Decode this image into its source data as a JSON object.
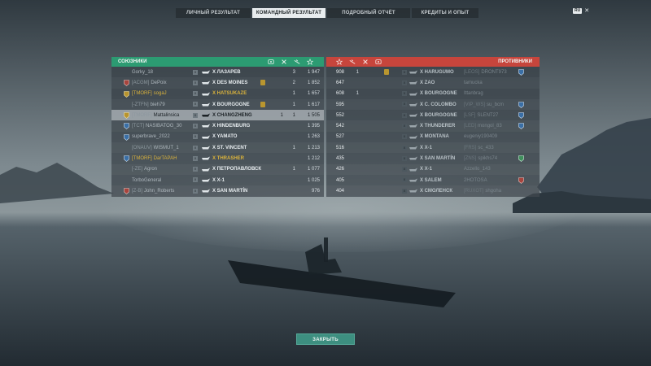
{
  "tabs": [
    {
      "label": "ЛИЧНЫЙ РЕЗУЛЬТАТ"
    },
    {
      "label": "КОМАНДНЫЙ РЕЗУЛЬТАТ"
    },
    {
      "label": "ПОДРОБНЫЙ ОТЧЁТ"
    },
    {
      "label": "КРЕДИТЫ И ОПЫТ"
    }
  ],
  "lang_badge": "RU",
  "close_glyph": "✕",
  "allies": {
    "title": "СОЮЗНИКИ",
    "color": "#2c9b72",
    "column_icons": [
      "plane-icon",
      "ship-kill-icon",
      "plane-kill-icon",
      "star-icon"
    ],
    "rows": [
      {
        "clan": "",
        "player": "Gorky_18",
        "tier": "X",
        "ship": "X ЛАЗАРЕВ",
        "badge": false,
        "kills": "",
        "planes": "3",
        "score": "1 947",
        "rank": "none",
        "hl": false,
        "gold": false
      },
      {
        "clan": "[ACGM]",
        "player": "DePoix",
        "tier": "X",
        "ship": "X DES MOINES",
        "badge": true,
        "kills": "",
        "planes": "2",
        "score": "1 852",
        "rank": "red",
        "hl": false,
        "gold": false
      },
      {
        "clan": "[TMORF]",
        "player": "sogaJ",
        "tier": "X",
        "ship": "X HATSUKAZE",
        "badge": false,
        "kills": "",
        "planes": "1",
        "score": "1 657",
        "rank": "gold",
        "hl": false,
        "gold": true
      },
      {
        "clan": "[-ZTFN]",
        "player": "bieh79",
        "tier": "X",
        "ship": "X BOURGOGNE",
        "badge": true,
        "kills": "",
        "planes": "1",
        "score": "1 617",
        "rank": "none",
        "hl": false,
        "gold": false
      },
      {
        "clan": "[TMORF]",
        "player": "Mattalinsica",
        "tier": "X",
        "ship": "X CHANGZHENG",
        "badge": false,
        "kills": "1",
        "planes": "1",
        "score": "1 505",
        "rank": "gold",
        "hl": true,
        "gold": false
      },
      {
        "clan": "[TCT]",
        "player": "NASIBATOG_30",
        "tier": "X",
        "ship": "X HINDENBURG",
        "badge": false,
        "kills": "",
        "planes": "",
        "score": "1 395",
        "rank": "blue",
        "hl": false,
        "gold": false
      },
      {
        "clan": "",
        "player": "superbrave_2022",
        "tier": "X",
        "ship": "X YAMATO",
        "badge": false,
        "kills": "",
        "planes": "",
        "score": "1 263",
        "rank": "blue",
        "hl": false,
        "gold": false
      },
      {
        "clan": "[ONAUV]",
        "player": "WISMUT_1",
        "tier": "X",
        "ship": "X ST. VINCENT",
        "badge": false,
        "kills": "",
        "planes": "1",
        "score": "1 213",
        "rank": "none",
        "hl": false,
        "gold": false
      },
      {
        "clan": "[TMORF]",
        "player": "DarTAPAH",
        "tier": "X",
        "ship": "X THRASHER",
        "badge": false,
        "kills": "",
        "planes": "",
        "score": "1 212",
        "rank": "blue",
        "hl": false,
        "gold": true
      },
      {
        "clan": "[-ZE]",
        "player": "Agron",
        "tier": "X",
        "ship": "X ПЕТРОПАВЛОВСК",
        "badge": false,
        "kills": "",
        "planes": "1",
        "score": "1 077",
        "rank": "none",
        "hl": false,
        "gold": false
      },
      {
        "clan": "",
        "player": "TorboGeneral",
        "tier": "X",
        "ship": "X X-1",
        "badge": false,
        "kills": "",
        "planes": "",
        "score": "1 025",
        "rank": "none",
        "hl": false,
        "gold": false
      },
      {
        "clan": "[Z-B]",
        "player": "John_Roberts",
        "tier": "X",
        "ship": "X SAN MARTÍN",
        "badge": false,
        "kills": "",
        "planes": "",
        "score": "976",
        "rank": "red",
        "hl": false,
        "gold": false
      }
    ]
  },
  "enemies": {
    "title": "ПРОТИВНИКИ",
    "color": "#c7453c",
    "column_icons": [
      "star-icon",
      "plane-kill-icon",
      "ship-kill-icon",
      "plane-icon"
    ],
    "rows": [
      {
        "score": "908",
        "planes": "1",
        "badge": true,
        "tier": "X",
        "ship": "X HARUGUMO",
        "clan": "[LEOS]",
        "player": "DRONT973",
        "rank": "blue"
      },
      {
        "score": "647",
        "planes": "",
        "badge": false,
        "tier": "X",
        "ship": "X ZAO",
        "clan": "",
        "player": "tamucka",
        "rank": "none"
      },
      {
        "score": "608",
        "planes": "1",
        "badge": false,
        "tier": "X",
        "ship": "X BOURGOGNE",
        "clan": "",
        "player": "Ittanbrag",
        "rank": "none"
      },
      {
        "score": "595",
        "planes": "",
        "badge": false,
        "tier": "X",
        "ship": "X C. COLOMBO",
        "clan": "[VIP_WS]",
        "player": "su_bcm",
        "rank": "blue"
      },
      {
        "score": "552",
        "planes": "",
        "badge": false,
        "tier": "X",
        "ship": "X BOURGOGNE",
        "clan": "[LSF]",
        "player": "SLENT27",
        "rank": "blue"
      },
      {
        "score": "542",
        "planes": "",
        "badge": false,
        "tier": "X",
        "ship": "X THUNDERER",
        "clan": "[LED]",
        "player": "mongol_83",
        "rank": "blue"
      },
      {
        "score": "527",
        "planes": "",
        "badge": false,
        "tier": "X",
        "ship": "X MONTANA",
        "clan": "",
        "player": "eugeniy190409",
        "rank": "none"
      },
      {
        "score": "516",
        "planes": "",
        "badge": false,
        "tier": "X",
        "ship": "X X-1",
        "clan": "[FRS]",
        "player": "sc_433",
        "rank": "none"
      },
      {
        "score": "435",
        "planes": "",
        "badge": false,
        "tier": "X",
        "ship": "X SAN MARTÍN",
        "clan": "[ZNS]",
        "player": "spikhs74",
        "rank": "green"
      },
      {
        "score": "426",
        "planes": "",
        "badge": false,
        "tier": "X",
        "ship": "X X-1",
        "clan": "",
        "player": "Azzello_143",
        "rank": "none"
      },
      {
        "score": "405",
        "planes": "",
        "badge": false,
        "tier": "X",
        "ship": "X SALEM",
        "clan": "",
        "player": "2HOTOSA",
        "rank": "red"
      },
      {
        "score": "404",
        "planes": "",
        "badge": false,
        "tier": "X",
        "ship": "X СМОЛЕНСК",
        "clan": "[RUXOT]",
        "player": "shgoha",
        "rank": "none"
      }
    ]
  },
  "close_button": "ЗАКРЫТЬ"
}
